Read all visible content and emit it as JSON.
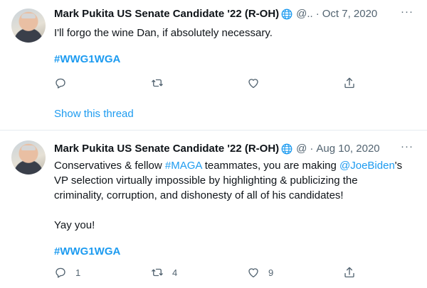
{
  "tweets": [
    {
      "author": "Mark Pukita US Senate Candidate '22 (R-OH)",
      "handle": "@..",
      "date": "Oct 7, 2020",
      "body": "I'll forgo the wine Dan, if absolutely necessary.",
      "hashtag": "#WWG1WGA",
      "reply_count": "",
      "retweet_count": "",
      "like_count": "",
      "show_thread": "Show this thread"
    },
    {
      "author": "Mark Pukita US Senate Candidate '22 (R-OH)",
      "handle": "@",
      "date": "Aug 10, 2020",
      "body_line1_a": "Conservatives & fellow ",
      "body_line1_tag": "#MAGA",
      "body_line1_b": " teammates, you are making ",
      "body_line1_mention": "@JoeBiden",
      "body_line1_c": "'s",
      "body_line2": "VP selection virtually impossible by highlighting & publicizing the",
      "body_line3": "criminality, corruption, and dishonesty of all of his candidates!",
      "body_line4": "Yay you!",
      "hashtag": "#WWG1WGA",
      "reply_count": "1",
      "retweet_count": "4",
      "like_count": "9"
    }
  ],
  "more_label": "···",
  "icons": [
    "globe-icon",
    "more-icon",
    "reply-icon",
    "retweet-icon",
    "like-icon",
    "share-icon"
  ],
  "colors": {
    "link": "#1d9bf0",
    "secondary": "#536471",
    "text": "#0f1419",
    "divider": "#e6ecf0"
  }
}
